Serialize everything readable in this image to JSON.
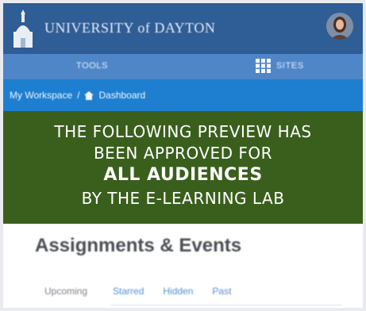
{
  "header": {
    "brand": "UNIVERSITY of DAYTON",
    "logo_icon": "chapel-icon",
    "avatar_icon": "user-avatar"
  },
  "nav": {
    "tools_label": "TOOLS",
    "sites_label": "SITES",
    "sites_icon": "grid-icon"
  },
  "breadcrumb": {
    "workspace": "My Workspace",
    "separator": "/",
    "dashboard": "Dashboard",
    "home_icon": "home-icon"
  },
  "banner": {
    "line1": "THE FOLLOWING PREVIEW HAS",
    "line2": "BEEN APPROVED FOR",
    "line3": "ALL AUDIENCES",
    "line4": "BY THE E-LEARNING LAB",
    "background": "#3a5f1d"
  },
  "panel": {
    "title": "Assignments & Events",
    "tabs": [
      "Upcoming",
      "Starred",
      "Hidden",
      "Past"
    ]
  },
  "colors": {
    "topbar": "#2f5d95",
    "toolsbar": "#4f86c8",
    "breadcrumb": "#1e7fd0",
    "link": "#4f8fd9"
  }
}
